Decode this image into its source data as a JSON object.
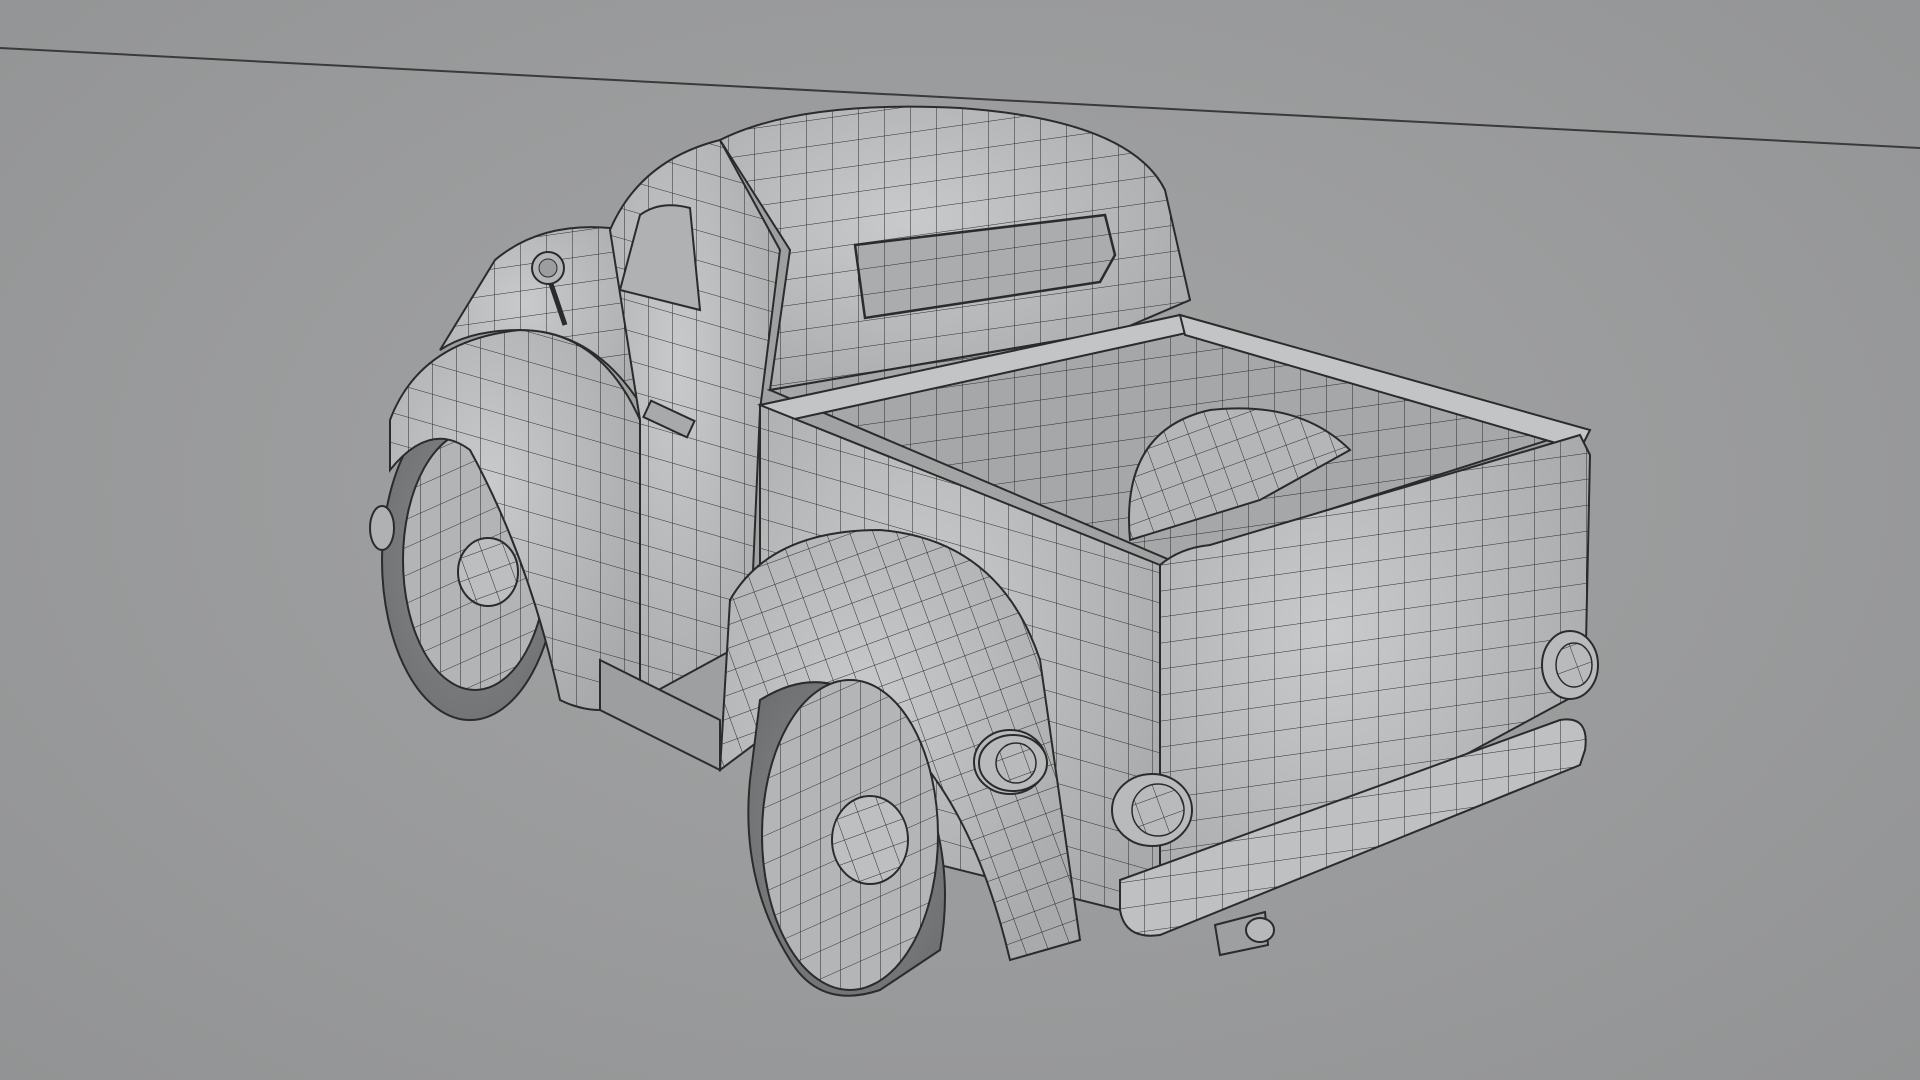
{
  "viewport": {
    "background_color": "#999a9b",
    "wire_color": "#2a2a2a",
    "surface_color": "#b9babb"
  },
  "scene": {
    "object": "pickup-truck-mesh",
    "display_mode": "wireframe-on-shaded"
  }
}
